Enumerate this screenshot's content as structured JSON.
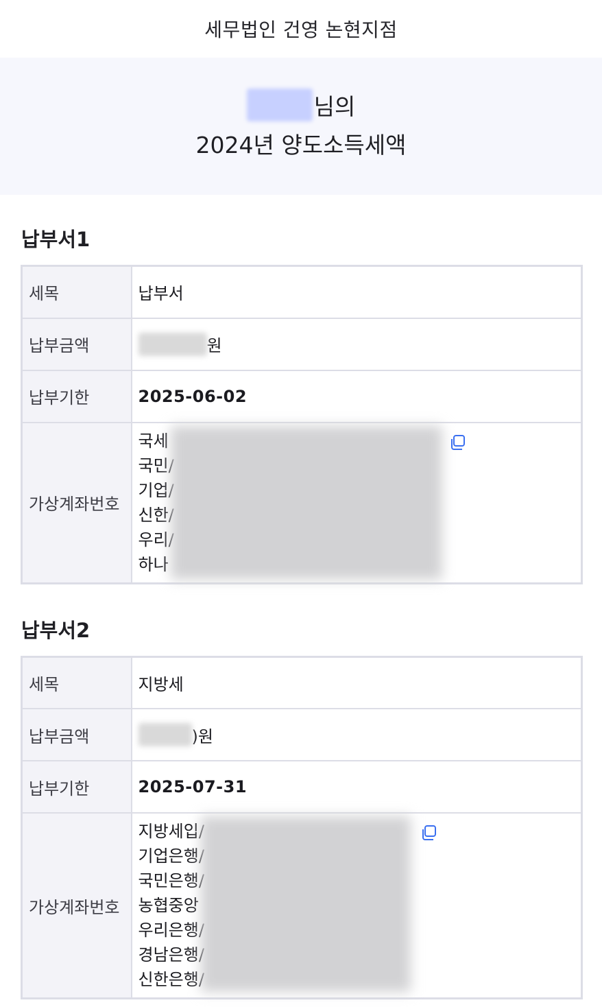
{
  "header": {
    "title": "세무법인 건영 논현지점"
  },
  "hero": {
    "suffix": "님의",
    "subtitle": "2024년 양도소득세액"
  },
  "labels": {
    "tax_item": "세목",
    "amount": "납부금액",
    "due": "납부기한",
    "account": "가상계좌번호"
  },
  "sections": [
    {
      "title": "납부서1",
      "tax_item": "납부서",
      "amount_unit": "원",
      "due": "2025-06-02",
      "accounts": [
        "국세",
        "국민/",
        "기업/",
        "신한/",
        "우리/",
        "하나"
      ]
    },
    {
      "title": "납부서2",
      "tax_item": "지방세",
      "amount_unit": ")원",
      "due": "2025-07-31",
      "accounts": [
        "지방세입/",
        "기업은행/",
        "국민은행/",
        "농협중앙",
        "우리은행/",
        "경남은행/",
        "신한은행/"
      ]
    }
  ],
  "icons": {
    "copy": "copy-icon"
  },
  "colors": {
    "accent": "#3a6ff0",
    "hero_bg": "#f6f7fd",
    "label_bg": "#f3f3f8"
  }
}
